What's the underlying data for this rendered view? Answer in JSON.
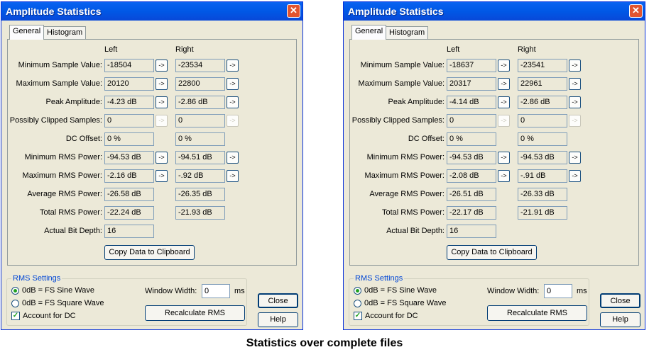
{
  "dialogs": [
    {
      "title": "Amplitude Statistics",
      "tabs": [
        "General",
        "Histogram"
      ],
      "column_left": "Left",
      "column_right": "Right",
      "rows": [
        {
          "label": "Minimum Sample Value:",
          "left": "-18504",
          "right": "-23534",
          "arrow": "->"
        },
        {
          "label": "Maximum Sample Value:",
          "left": "20120",
          "right": "22800",
          "arrow": "->"
        },
        {
          "label": "Peak Amplitude:",
          "left": "-4.23 dB",
          "right": "-2.86 dB",
          "arrow": "->"
        },
        {
          "label": "Possibly Clipped Samples:",
          "left": "0",
          "right": "0",
          "arrow": "->"
        },
        {
          "label": "DC Offset:",
          "left": "0 %",
          "right": "0 %",
          "arrow": ""
        },
        {
          "label": "Minimum RMS Power:",
          "left": "-94.53 dB",
          "right": "-94.51 dB",
          "arrow": "->"
        },
        {
          "label": "Maximum RMS Power:",
          "left": "-2.16 dB",
          "right": "-.92 dB",
          "arrow": "->"
        },
        {
          "label": "Average RMS Power:",
          "left": "-26.58 dB",
          "right": "-26.35 dB",
          "arrow": ""
        },
        {
          "label": "Total RMS Power:",
          "left": "-22.24 dB",
          "right": "-21.93 dB",
          "arrow": ""
        },
        {
          "label": "Actual Bit Depth:",
          "left": "16",
          "right": "",
          "arrow": ""
        }
      ],
      "copy_button": "Copy Data to Clipboard",
      "rms_settings": {
        "title": "RMS Settings",
        "option_sine": "0dB = FS Sine Wave",
        "option_square": "0dB = FS Square Wave",
        "account_dc": "Account for DC",
        "window_width_label": "Window Width:",
        "window_width_value": "0",
        "window_width_unit": "ms",
        "recalc_button": "Recalculate RMS"
      },
      "close_button": "Close",
      "help_button": "Help"
    },
    {
      "title": "Amplitude Statistics",
      "tabs": [
        "General",
        "Histogram"
      ],
      "column_left": "Left",
      "column_right": "Right",
      "rows": [
        {
          "label": "Minimum Sample Value:",
          "left": "-18637",
          "right": "-23541",
          "arrow": "->"
        },
        {
          "label": "Maximum Sample Value:",
          "left": "20317",
          "right": "22961",
          "arrow": "->"
        },
        {
          "label": "Peak Amplitude:",
          "left": "-4.14 dB",
          "right": "-2.86 dB",
          "arrow": "->"
        },
        {
          "label": "Possibly Clipped Samples:",
          "left": "0",
          "right": "0",
          "arrow": "->"
        },
        {
          "label": "DC Offset:",
          "left": "0 %",
          "right": "0 %",
          "arrow": ""
        },
        {
          "label": "Minimum RMS Power:",
          "left": "-94.53 dB",
          "right": "-94.53 dB",
          "arrow": "->"
        },
        {
          "label": "Maximum RMS Power:",
          "left": "-2.08 dB",
          "right": "-.91 dB",
          "arrow": "->"
        },
        {
          "label": "Average RMS Power:",
          "left": "-26.51 dB",
          "right": "-26.33 dB",
          "arrow": ""
        },
        {
          "label": "Total RMS Power:",
          "left": "-22.17 dB",
          "right": "-21.91 dB",
          "arrow": ""
        },
        {
          "label": "Actual Bit Depth:",
          "left": "16",
          "right": "",
          "arrow": ""
        }
      ],
      "copy_button": "Copy Data to Clipboard",
      "rms_settings": {
        "title": "RMS Settings",
        "option_sine": "0dB = FS Sine Wave",
        "option_square": "0dB = FS Square Wave",
        "account_dc": "Account for DC",
        "window_width_label": "Window Width:",
        "window_width_value": "0",
        "window_width_unit": "ms",
        "recalc_button": "Recalculate RMS"
      },
      "close_button": "Close",
      "help_button": "Help"
    }
  ],
  "caption": "Statistics over complete files"
}
